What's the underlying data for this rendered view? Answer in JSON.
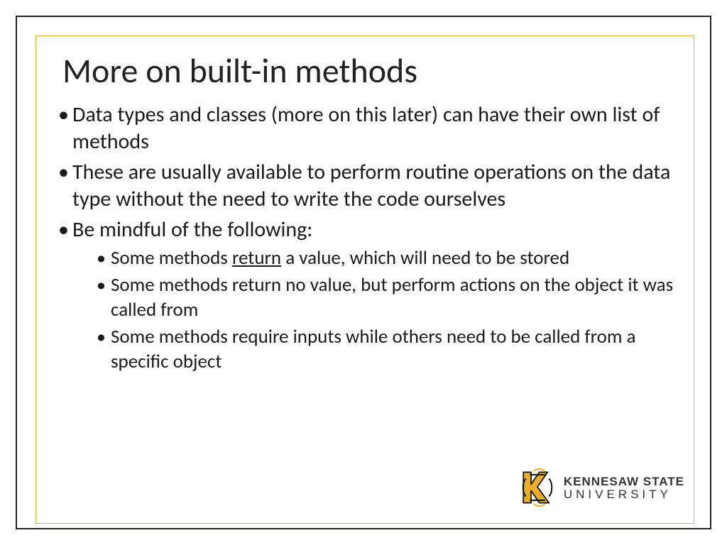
{
  "title": "More on built-in methods",
  "bullets": [
    {
      "text": "Data types and classes (more on this later) can have their own list of methods"
    },
    {
      "text": "These are usually available to perform routine operations on the data type without the need to write the code ourselves"
    },
    {
      "text": "Be mindful of the following:",
      "sub": [
        {
          "pre": "Some methods ",
          "underlined": "return",
          "post": " a value, which will need to be stored"
        },
        {
          "text": "Some methods return no value, but perform actions on the object it was called from"
        },
        {
          "text": "Some methods require inputs while others need to be called from a specific object"
        }
      ]
    }
  ],
  "logo": {
    "top": "KENNESAW STATE",
    "bottom": "UNIVERSITY"
  }
}
